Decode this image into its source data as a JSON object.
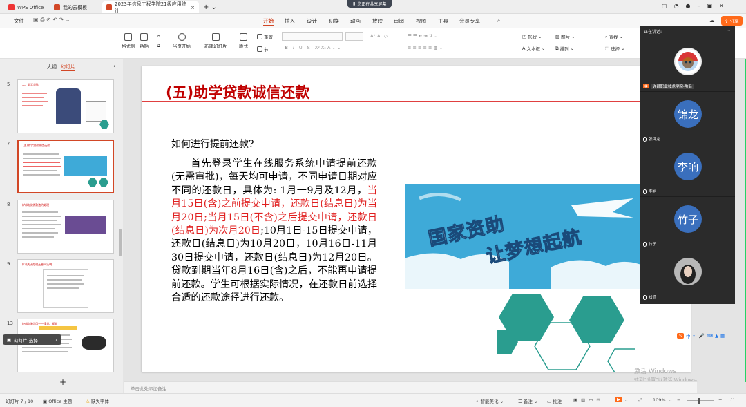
{
  "tabs": [
    {
      "label": "WPS Office"
    },
    {
      "label": "我的云模板"
    },
    {
      "label": "2023年信息工程学院21级应用统计..."
    }
  ],
  "share_banner": "您正在共享屏幕",
  "menu": {
    "file": "三 文件",
    "items": [
      "开始",
      "插入",
      "设计",
      "切换",
      "动画",
      "放映",
      "审阅",
      "视图",
      "工具",
      "会员专享"
    ]
  },
  "toolbar": {
    "format_painter": "格式刷",
    "paste": "粘贴",
    "from_current": "当页开始",
    "new_slide": "新建幻灯片",
    "layout": "版式",
    "section": "节",
    "reset": "重置",
    "shape": "形状",
    "picture": "图片",
    "textbox": "文本框",
    "arrange": "排列",
    "find": "查找",
    "select": "选择",
    "share": "分享"
  },
  "sidebar": {
    "outline_tab": "大纲",
    "slides_tab": "幻灯片",
    "slide_numbers": [
      "5",
      "7",
      "8",
      "9",
      "13"
    ],
    "thumb_titles": [
      "二、助学贷款",
      "(五)助学贷款诚信还款",
      "(六)助学贷款违约处理",
      "(八)关于办理无意义证明",
      "(五)助学信用——续贷、延期"
    ],
    "selection_hint": "幻灯片 选择"
  },
  "slide": {
    "title": "(五)助学贷款诚信还款",
    "question": "如何进行提前还款?",
    "para_1": "首先登录学生在线服务系统申请提前还款(无需审批)，每天均可申请，不同申请日期对应不同的还款日，具体为: 1月一9月及12月，",
    "para_red": "当月15日(含)之前提交申请，还款日(结息日)为当月20日;当月15日(不含)之后提交申请，还款日(结息日)为次月20日",
    "para_2": ";10月1日-15日提交申请，还款日(结息日)为10月20日，10月16日-11月30日提交申请，还款日(结息日)为12月20日。贷款到期当年8月16日(含)之后，不能再申请提前还款。学生可根据实际情况，在还款日前选择合适的还款途径进行还款。",
    "banner_line1": "国家资助",
    "banner_line2": "让梦想起航"
  },
  "video_panel": {
    "header": "正在讲话:",
    "participants": [
      {
        "name": "许昌职业技术学院-陶侣",
        "avatar": ""
      },
      {
        "name": "张锦龙",
        "avatar": "锦龙"
      },
      {
        "name": "李响",
        "avatar": "李响"
      },
      {
        "name": "竹子",
        "avatar": "竹子"
      },
      {
        "name": "知道",
        "avatar": ""
      }
    ]
  },
  "notes_placeholder": "单击此处添加备注",
  "status": {
    "slide_pos": "幻灯片 7 / 10",
    "theme": "Office 主题",
    "missing_font": "缺失字体",
    "smart_beautify": "智能美化",
    "notes": "备注",
    "comments": "批注",
    "zoom": "109%"
  },
  "watermark": {
    "line1": "激活 Windows",
    "line2": "转到\"设置\"以激活 Windows。"
  },
  "colors": {
    "accent": "#d24726",
    "title_red": "#c00000",
    "banner_blue": "#3eaad8",
    "hex_teal": "#2a9d8f",
    "avatar_blue": "#3a6fbd"
  }
}
